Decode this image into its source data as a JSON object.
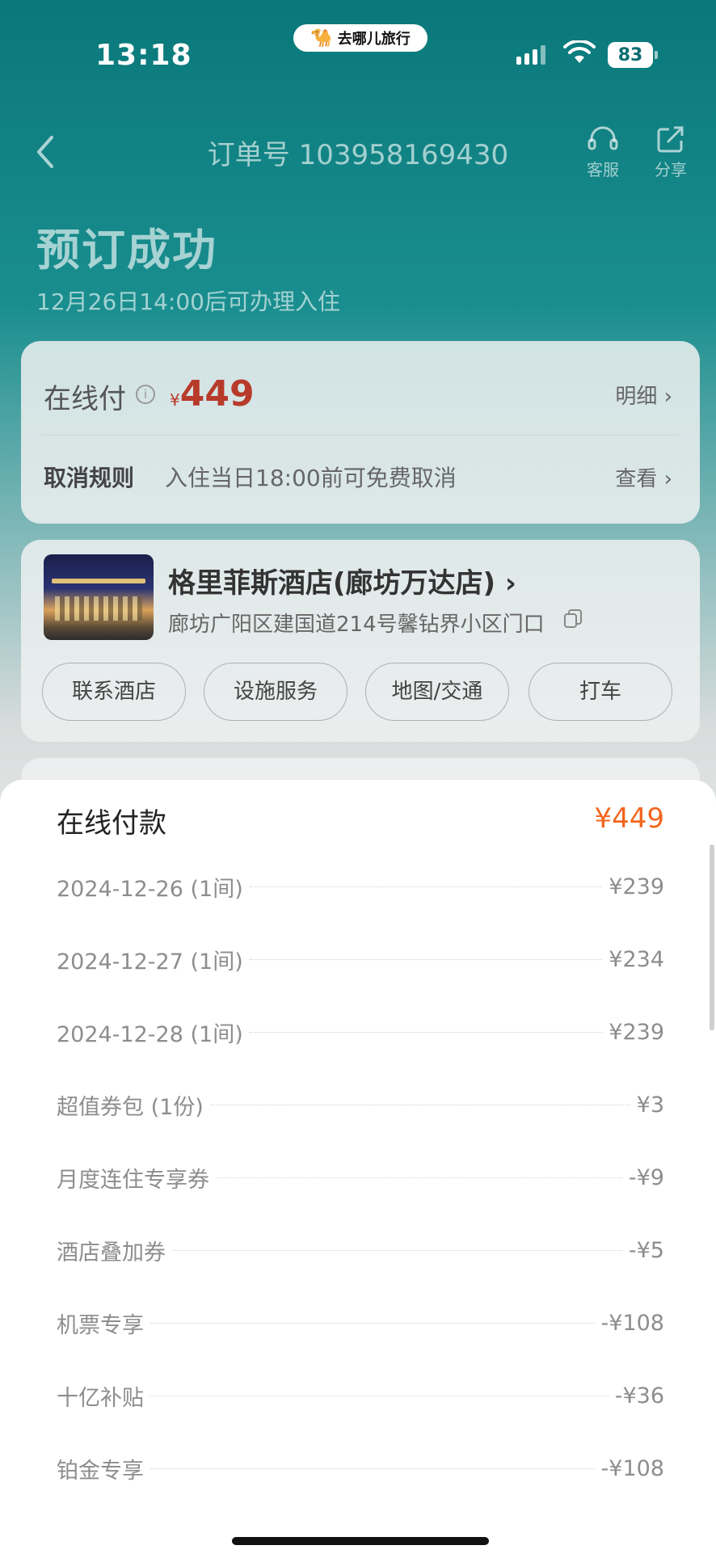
{
  "status_bar": {
    "time": "13:18",
    "app_badge": "去哪儿旅行",
    "battery": "83"
  },
  "nav": {
    "order_title": "订单号 103958169430",
    "service_label": "客服",
    "share_label": "分享"
  },
  "header": {
    "title": "预订成功",
    "checkin_note": "12月26日14:00后可办理入住"
  },
  "payment_card": {
    "label": "在线付",
    "currency": "¥",
    "amount": "449",
    "detail_link": "明细 ›",
    "cancel_label": "取消规则",
    "cancel_text": "入住当日18:00前可免费取消",
    "view_link": "查看 ›"
  },
  "hotel": {
    "name": "格里菲斯酒店(廊坊万达店) ›",
    "address": "廊坊广阳区建国道214号馨钻界小区门口",
    "buttons": [
      "联系酒店",
      "设施服务",
      "地图/交通",
      "打车"
    ]
  },
  "sheet": {
    "title": "在线付款",
    "total": "¥449",
    "rows": [
      {
        "label": "2024-12-26 (1间)",
        "value": "¥239"
      },
      {
        "label": "2024-12-27 (1间)",
        "value": "¥234"
      },
      {
        "label": "2024-12-28 (1间)",
        "value": "¥239"
      },
      {
        "label": "超值券包 (1份)",
        "value": "¥3"
      },
      {
        "label": "月度连住专享券",
        "value": "-¥9"
      },
      {
        "label": "酒店叠加券",
        "value": "-¥5"
      },
      {
        "label": "机票专享",
        "value": "-¥108"
      },
      {
        "label": "十亿补贴",
        "value": "-¥36"
      },
      {
        "label": "铂金专享",
        "value": "-¥108"
      }
    ]
  },
  "colors": {
    "header_teal": "#0a787a",
    "price_red": "#b83a2b",
    "total_orange": "#f2661e"
  }
}
